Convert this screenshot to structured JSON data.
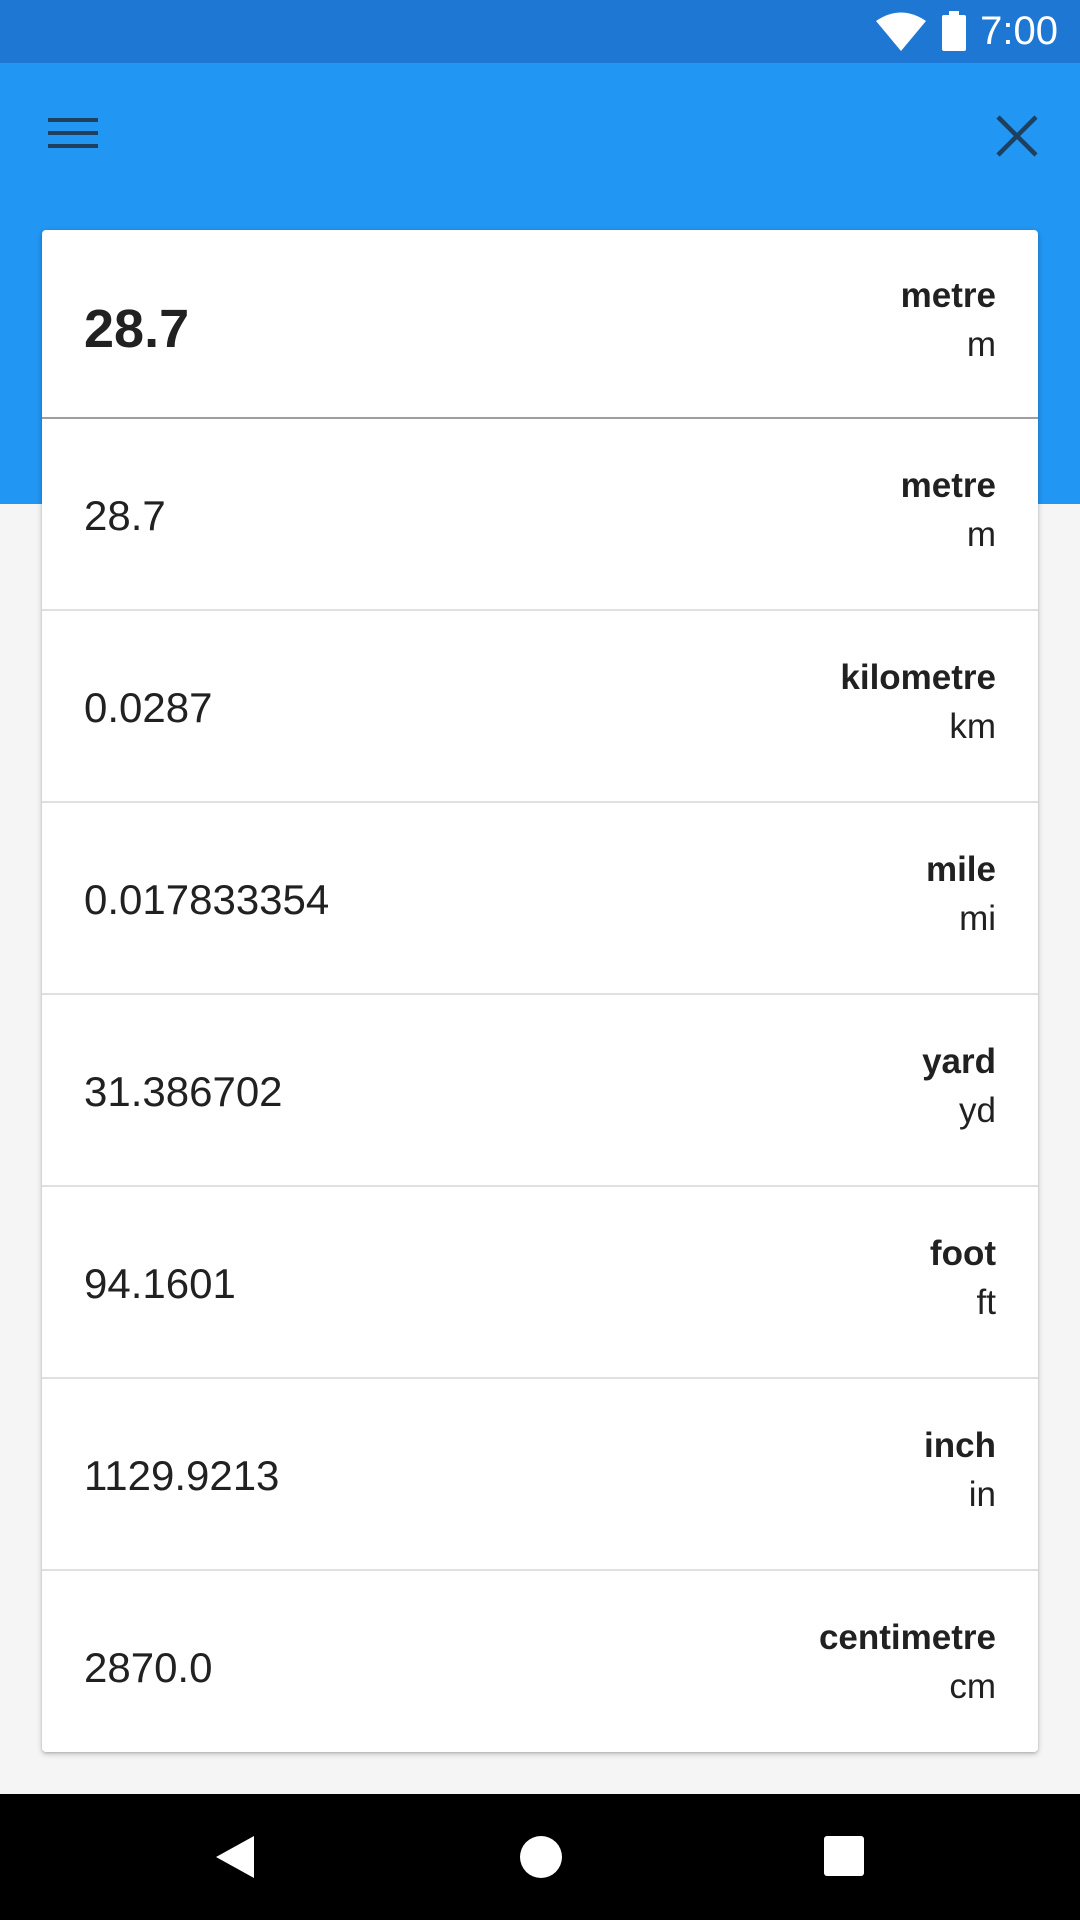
{
  "status_bar": {
    "time": "7:00",
    "wifi_icon": "wifi-icon",
    "battery_icon": "battery-icon"
  },
  "app_bar": {
    "menu_icon": "menu-icon",
    "close_icon": "close-icon",
    "color": "#2196f3",
    "status_color": "#1e77d2"
  },
  "input": {
    "value": "28.7",
    "unit_name": "metre",
    "unit_symbol": "m"
  },
  "results": [
    {
      "value": "28.7",
      "unit_name": "metre",
      "unit_symbol": "m"
    },
    {
      "value": "0.0287",
      "unit_name": "kilometre",
      "unit_symbol": "km"
    },
    {
      "value": "0.017833354",
      "unit_name": "mile",
      "unit_symbol": "mi"
    },
    {
      "value": "31.386702",
      "unit_name": "yard",
      "unit_symbol": "yd"
    },
    {
      "value": "94.1601",
      "unit_name": "foot",
      "unit_symbol": "ft"
    },
    {
      "value": "1129.9213",
      "unit_name": "inch",
      "unit_symbol": "in"
    },
    {
      "value": "2870.0",
      "unit_name": "centimetre",
      "unit_symbol": "cm"
    }
  ],
  "nav_bar": {
    "back_icon": "back-icon",
    "home_icon": "home-icon",
    "recents_icon": "recents-icon"
  }
}
